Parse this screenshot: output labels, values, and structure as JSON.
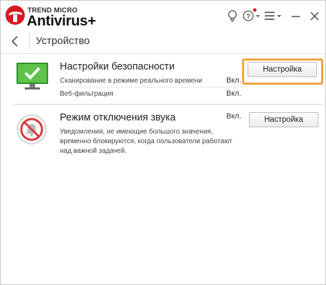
{
  "app": {
    "brand_small": "TREND MICRO",
    "brand_name": "Antivirus+",
    "accent_color": "#d71920"
  },
  "titlebar": {
    "icons": [
      "lightbulb-icon",
      "help-icon",
      "menu-icon",
      "minimize-icon",
      "close-icon"
    ]
  },
  "nav": {
    "title": "Устройство"
  },
  "security_section": {
    "title": "Настройки безопасности",
    "rows": [
      {
        "label": "Сканирование в режиме реального времени",
        "value": "Вкл."
      },
      {
        "label": "Веб-фильтрация",
        "value": "Вкл."
      }
    ],
    "button_label": "Настройка",
    "icon": "monitor-check-icon",
    "highlight_color": "#f2a340"
  },
  "silent_section": {
    "title": "Режим отключения звука",
    "value": "Вкл.",
    "description": "Уведомления, не имеющие большого значения, временно блокируются, когда пользователи работают над важной задачей.",
    "button_label": "Настройка",
    "icon": "muted-bell-icon"
  }
}
